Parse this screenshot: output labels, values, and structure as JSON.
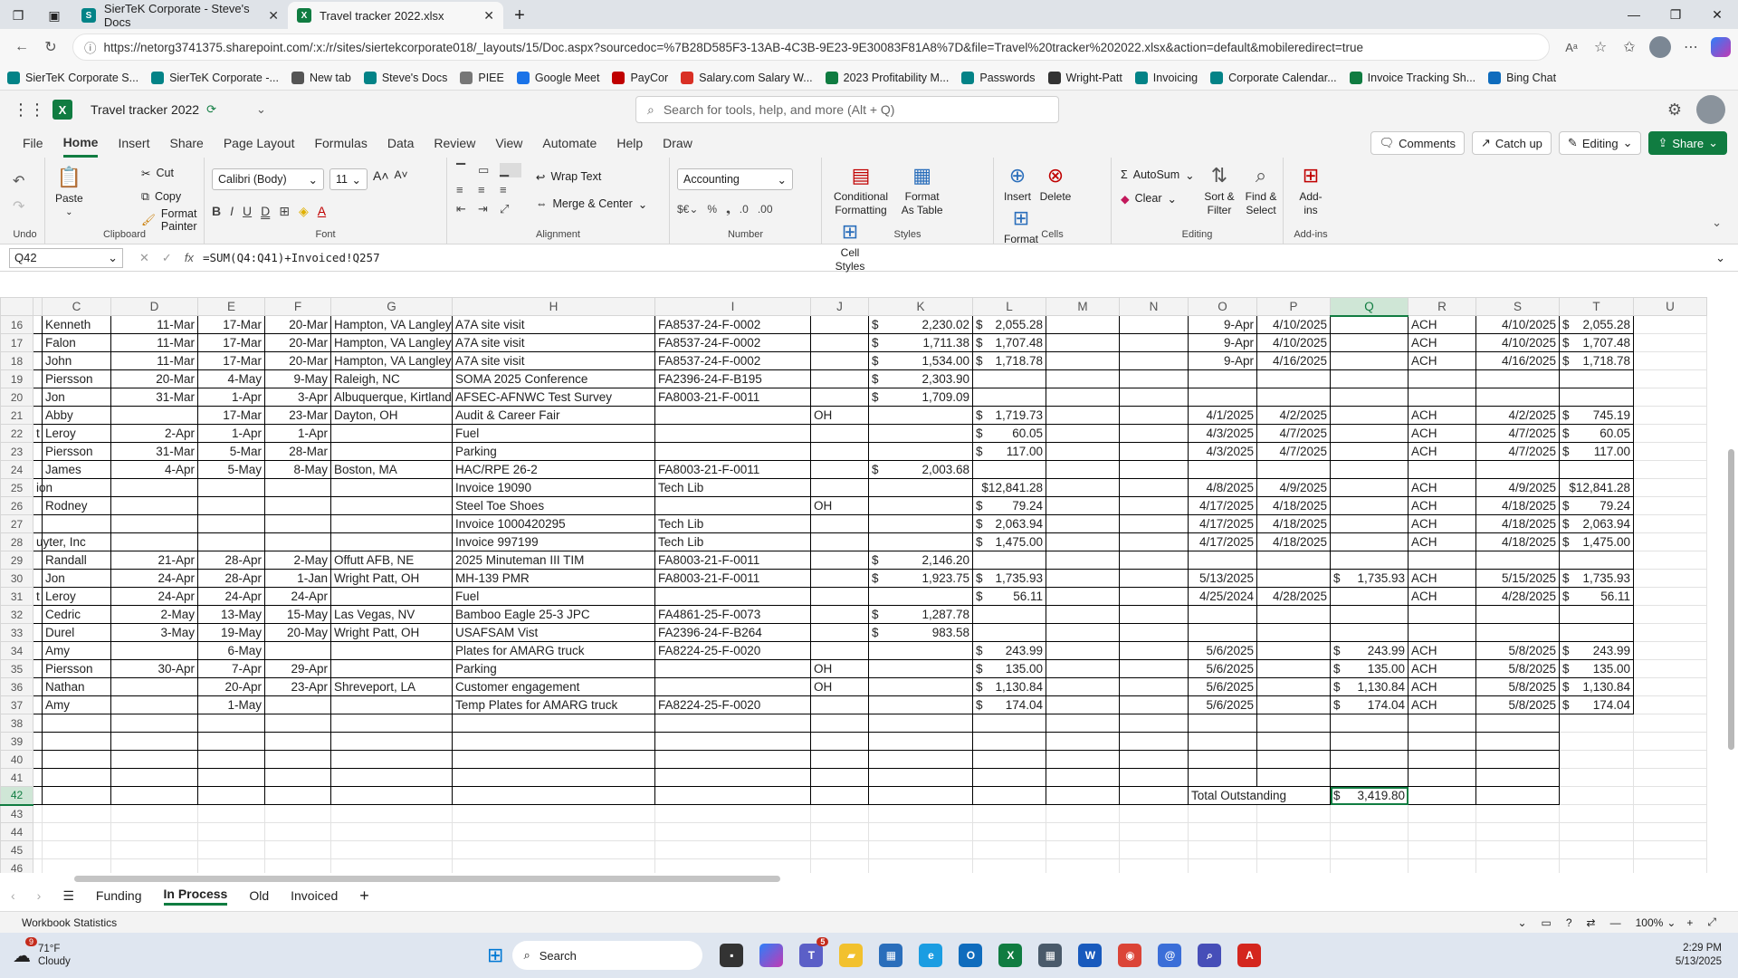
{
  "browser": {
    "tabs": [
      {
        "label": "SierTeK Corporate - Steve's Docs",
        "active": false
      },
      {
        "label": "Travel tracker 2022.xlsx",
        "active": true
      }
    ],
    "url": "https://netorg3741375.sharepoint.com/:x:/r/sites/siertekcorporate018/_layouts/15/Doc.aspx?sourcedoc=%7B28D585F3-13AB-4C3B-9E23-9E30083F81A8%7D&file=Travel%20tracker%202022.xlsx&action=default&mobileredirect=true",
    "bookmarks": [
      "SierTeK Corporate S...",
      "SierTeK Corporate -...",
      "New tab",
      "Steve's Docs",
      "PIEE",
      "Google Meet",
      "PayCor",
      "Salary.com Salary W...",
      "2023 Profitability M...",
      "Passwords",
      "Wright-Patt",
      "Invoicing",
      "Corporate Calendar...",
      "Invoice Tracking Sh...",
      "Bing Chat"
    ]
  },
  "excel": {
    "doc_title": "Travel tracker 2022",
    "search_placeholder": "Search for tools, help, and more (Alt + Q)",
    "menu": [
      "File",
      "Home",
      "Insert",
      "Share",
      "Page Layout",
      "Formulas",
      "Data",
      "Review",
      "View",
      "Automate",
      "Help",
      "Draw"
    ],
    "buttons": {
      "comments": "Comments",
      "catchup": "Catch up",
      "editing": "Editing",
      "share": "Share"
    },
    "ribbon": {
      "undo_group": "Undo",
      "clipboard": {
        "name": "Clipboard",
        "paste": "Paste",
        "cut": "Cut",
        "copy": "Copy",
        "format_painter": "Format Painter"
      },
      "font": {
        "name": "Font",
        "family": "Calibri (Body)",
        "size": "11"
      },
      "alignment": {
        "name": "Alignment",
        "wrap": "Wrap Text",
        "merge": "Merge & Center"
      },
      "number": {
        "name": "Number",
        "format": "Accounting"
      },
      "styles": {
        "name": "Styles",
        "cond": "Conditional Formatting",
        "table": "Format As Table",
        "cell": "Cell Styles"
      },
      "cells": {
        "name": "Cells",
        "insert": "Insert",
        "delete": "Delete",
        "format": "Format"
      },
      "editing": {
        "name": "Editing",
        "autosum": "AutoSum",
        "clear": "Clear",
        "sort": "Sort & Filter",
        "find": "Find & Select"
      },
      "addins": {
        "name": "Add-ins",
        "label": "Add-ins"
      }
    },
    "name_box": "Q42",
    "formula": "=SUM(Q4:Q41)+Invoiced!Q257",
    "columns": [
      "C",
      "D",
      "E",
      "F",
      "G",
      "H",
      "I",
      "J",
      "K",
      "L",
      "M",
      "N",
      "O",
      "P",
      "Q",
      "R",
      "S",
      "T",
      "U"
    ],
    "rows": [
      {
        "n": "16",
        "B": "",
        "C": "Kenneth",
        "D": "11-Mar",
        "E": "17-Mar",
        "F": "20-Mar",
        "G": "Hampton, VA Langley",
        "H": "A7A site visit",
        "I": "FA8537-24-F-0002",
        "J": "",
        "K": "2,230.02",
        "L": "2,055.28",
        "O": "9-Apr",
        "P": "4/10/2025",
        "Q": "",
        "R": "ACH",
        "S": "4/10/2025",
        "T": "2,055.28"
      },
      {
        "n": "17",
        "B": "",
        "C": "Falon",
        "D": "11-Mar",
        "E": "17-Mar",
        "F": "20-Mar",
        "G": "Hampton, VA Langley",
        "H": "A7A site visit",
        "I": "FA8537-24-F-0002",
        "J": "",
        "K": "1,711.38",
        "L": "1,707.48",
        "O": "9-Apr",
        "P": "4/10/2025",
        "Q": "",
        "R": "ACH",
        "S": "4/10/2025",
        "T": "1,707.48"
      },
      {
        "n": "18",
        "B": "",
        "C": "John",
        "D": "11-Mar",
        "E": "17-Mar",
        "F": "20-Mar",
        "G": "Hampton, VA Langley",
        "H": "A7A site visit",
        "I": "FA8537-24-F-0002",
        "J": "",
        "K": "1,534.00",
        "L": "1,718.78",
        "O": "9-Apr",
        "P": "4/16/2025",
        "Q": "",
        "R": "ACH",
        "S": "4/16/2025",
        "T": "1,718.78"
      },
      {
        "n": "19",
        "B": "",
        "C": "Piersson",
        "D": "20-Mar",
        "E": "4-May",
        "F": "9-May",
        "G": "Raleigh, NC",
        "H": "SOMA 2025 Conference",
        "I": "FA2396-24-F-B195",
        "J": "",
        "K": "2,303.90",
        "L": "",
        "O": "",
        "P": "",
        "Q": "",
        "R": "",
        "S": "",
        "T": ""
      },
      {
        "n": "20",
        "B": "",
        "C": "Jon",
        "D": "31-Mar",
        "E": "1-Apr",
        "F": "3-Apr",
        "G": "Albuquerque, Kirtland",
        "H": "AFSEC-AFNWC Test Survey",
        "I": "FA8003-21-F-0011",
        "J": "",
        "K": "1,709.09",
        "L": "",
        "O": "",
        "P": "",
        "Q": "",
        "R": "",
        "S": "",
        "T": ""
      },
      {
        "n": "21",
        "B": "",
        "C": "Abby",
        "D": "",
        "E": "17-Mar",
        "F": "23-Mar",
        "G": "Dayton, OH",
        "H": "Audit & Career Fair",
        "I": "",
        "J": "OH",
        "K": "",
        "L": "1,719.73",
        "O": "4/1/2025",
        "P": "4/2/2025",
        "Q": "",
        "R": "ACH",
        "S": "4/2/2025",
        "T": "745.19"
      },
      {
        "n": "22",
        "B": "t",
        "C": "Leroy",
        "D": "2-Apr",
        "E": "1-Apr",
        "F": "1-Apr",
        "G": "",
        "H": "Fuel",
        "I": "",
        "J": "",
        "K": "",
        "L": "60.05",
        "O": "4/3/2025",
        "P": "4/7/2025",
        "Q": "",
        "R": "ACH",
        "S": "4/7/2025",
        "T": "60.05"
      },
      {
        "n": "23",
        "B": "",
        "C": "Piersson",
        "D": "31-Mar",
        "E": "5-Mar",
        "F": "28-Mar",
        "G": "",
        "H": "Parking",
        "I": "",
        "J": "",
        "K": "",
        "L": "117.00",
        "O": "4/3/2025",
        "P": "4/7/2025",
        "Q": "",
        "R": "ACH",
        "S": "4/7/2025",
        "T": "117.00"
      },
      {
        "n": "24",
        "B": "",
        "C": "James",
        "D": "4-Apr",
        "E": "5-May",
        "F": "8-May",
        "G": "Boston, MA",
        "H": "HAC/RPE 26-2",
        "I": "FA8003-21-F-0011",
        "J": "",
        "K": "2,003.68",
        "L": "",
        "O": "",
        "P": "",
        "Q": "",
        "R": "",
        "S": "",
        "T": ""
      },
      {
        "n": "25",
        "B": "ion",
        "C": "",
        "D": "",
        "E": "",
        "F": "",
        "G": "",
        "H": "Invoice 19090",
        "I": "Tech Lib",
        "J": "",
        "K": "",
        "L": "$12,841.28",
        "O": "4/8/2025",
        "P": "4/9/2025",
        "Q": "",
        "R": "ACH",
        "S": "4/9/2025",
        "T": "$12,841.28"
      },
      {
        "n": "26",
        "B": "",
        "C": "Rodney",
        "D": "",
        "E": "",
        "F": "",
        "G": "",
        "H": "Steel Toe Shoes",
        "I": "",
        "J": "OH",
        "K": "",
        "L": "79.24",
        "O": "4/17/2025",
        "P": "4/18/2025",
        "Q": "",
        "R": "ACH",
        "S": "4/18/2025",
        "T": "79.24"
      },
      {
        "n": "27",
        "B": "",
        "C": "",
        "D": "",
        "E": "",
        "F": "",
        "G": "",
        "H": "Invoice 1000420295",
        "I": "Tech Lib",
        "J": "",
        "K": "",
        "L": "2,063.94",
        "O": "4/17/2025",
        "P": "4/18/2025",
        "Q": "",
        "R": "ACH",
        "S": "4/18/2025",
        "T": "2,063.94"
      },
      {
        "n": "28",
        "B": "uyter, Inc",
        "C": "",
        "D": "",
        "E": "",
        "F": "",
        "G": "",
        "H": "Invoice 997199",
        "I": "Tech Lib",
        "J": "",
        "K": "",
        "L": "1,475.00",
        "O": "4/17/2025",
        "P": "4/18/2025",
        "Q": "",
        "R": "ACH",
        "S": "4/18/2025",
        "T": "1,475.00"
      },
      {
        "n": "29",
        "B": "",
        "C": "Randall",
        "D": "21-Apr",
        "E": "28-Apr",
        "F": "2-May",
        "G": "Offutt AFB, NE",
        "H": "2025 Minuteman III TIM",
        "I": "FA8003-21-F-0011",
        "J": "",
        "K": "2,146.20",
        "L": "",
        "O": "",
        "P": "",
        "Q": "",
        "R": "",
        "S": "",
        "T": ""
      },
      {
        "n": "30",
        "B": "",
        "C": "Jon",
        "D": "24-Apr",
        "E": "28-Apr",
        "F": "1-Jan",
        "G": "Wright Patt, OH",
        "H": "MH-139 PMR",
        "I": "FA8003-21-F-0011",
        "J": "",
        "K": "1,923.75",
        "L": "1,735.93",
        "O": "5/13/2025",
        "P": "",
        "Q": "1,735.93",
        "R": "ACH",
        "S": "5/15/2025",
        "T": "1,735.93"
      },
      {
        "n": "31",
        "B": "t",
        "C": "Leroy",
        "D": "24-Apr",
        "E": "24-Apr",
        "F": "24-Apr",
        "G": "",
        "H": "Fuel",
        "I": "",
        "J": "",
        "K": "",
        "L": "56.11",
        "O": "4/25/2024",
        "P": "4/28/2025",
        "Q": "",
        "R": "ACH",
        "S": "4/28/2025",
        "T": "56.11"
      },
      {
        "n": "32",
        "B": "",
        "C": "Cedric",
        "D": "2-May",
        "E": "13-May",
        "F": "15-May",
        "G": "Las Vegas, NV",
        "H": "Bamboo Eagle 25-3 JPC",
        "I": "FA4861-25-F-0073",
        "J": "",
        "K": "1,287.78",
        "L": "",
        "O": "",
        "P": "",
        "Q": "",
        "R": "",
        "S": "",
        "T": ""
      },
      {
        "n": "33",
        "B": "",
        "C": "Durel",
        "D": "3-May",
        "E": "19-May",
        "F": "20-May",
        "G": "Wright Patt, OH",
        "H": "USAFSAM Vist",
        "I": "FA2396-24-F-B264",
        "J": "",
        "K": "983.58",
        "L": "",
        "O": "",
        "P": "",
        "Q": "",
        "R": "",
        "S": "",
        "T": ""
      },
      {
        "n": "34",
        "B": "",
        "C": "Amy",
        "D": "",
        "E": "6-May",
        "F": "",
        "G": "",
        "H": "Plates for AMARG truck",
        "I": "FA8224-25-F-0020",
        "J": "",
        "K": "",
        "L": "243.99",
        "O": "5/6/2025",
        "P": "",
        "Q": "243.99",
        "R": "ACH",
        "S": "5/8/2025",
        "T": "243.99"
      },
      {
        "n": "35",
        "B": "",
        "C": "Piersson",
        "D": "30-Apr",
        "E": "7-Apr",
        "F": "29-Apr",
        "G": "",
        "H": "Parking",
        "I": "",
        "J": "OH",
        "K": "",
        "L": "135.00",
        "O": "5/6/2025",
        "P": "",
        "Q": "135.00",
        "R": "ACH",
        "S": "5/8/2025",
        "T": "135.00"
      },
      {
        "n": "36",
        "B": "",
        "C": "Nathan",
        "D": "",
        "E": "20-Apr",
        "F": "23-Apr",
        "G": "Shreveport, LA",
        "H": "Customer engagement",
        "I": "",
        "J": "OH",
        "K": "",
        "L": "1,130.84",
        "O": "5/6/2025",
        "P": "",
        "Q": "1,130.84",
        "R": "ACH",
        "S": "5/8/2025",
        "T": "1,130.84"
      },
      {
        "n": "37",
        "B": "",
        "C": "Amy",
        "D": "",
        "E": "1-May",
        "F": "",
        "G": "",
        "H": "Temp Plates for AMARG truck",
        "I": "FA8224-25-F-0020",
        "J": "",
        "K": "",
        "L": "174.04",
        "O": "5/6/2025",
        "P": "",
        "Q": "174.04",
        "R": "ACH",
        "S": "5/8/2025",
        "T": "174.04"
      }
    ],
    "empty_rows": [
      "38",
      "39",
      "40",
      "41"
    ],
    "total_row": {
      "n": "42",
      "label": "Total Outstanding",
      "value": "3,419.80"
    },
    "tail_rows": [
      "43",
      "44",
      "45",
      "46"
    ],
    "sheets": [
      "Funding",
      "In Process",
      "Old",
      "Invoiced"
    ],
    "active_sheet": "In Process",
    "status_left": "Workbook Statistics",
    "zoom": "100%"
  },
  "taskbar": {
    "temp": "71°F",
    "weather": "Cloudy",
    "weather_badge": "9",
    "search": "Search",
    "teams_badge": "5",
    "time": "2:29 PM",
    "date": "5/13/2025"
  },
  "colors": {
    "excel_green": "#107c41",
    "tab_bar": "#dfe3e8"
  }
}
